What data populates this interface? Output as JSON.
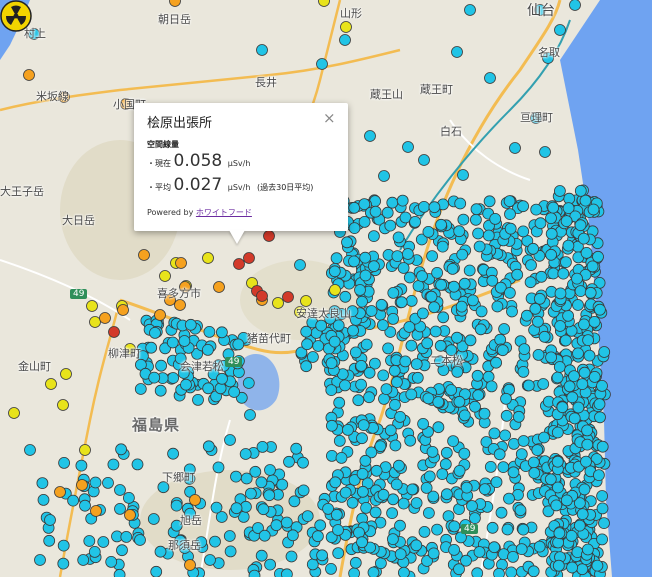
{
  "map": {
    "colors": {
      "land": "#eae7dc",
      "sea": "#6fa3f1",
      "lake": "#8fb4ea",
      "highway": "#f3bc52",
      "road": "#ffffff",
      "rail": "#33a0b0",
      "marker_cyan": "#21c4e6",
      "marker_yellow": "#e8e31b",
      "marker_orange": "#f5a11f",
      "marker_red": "#d23a2a",
      "marker_stroke": "#3a3a3a"
    },
    "place_labels": [
      "村上",
      "朝日岳",
      "山形",
      "仙台",
      "米坂線",
      "小国町",
      "長井",
      "蔵王山",
      "名取",
      "蔵王町",
      "白石",
      "亘理町",
      "大王子岳",
      "大日岳",
      "喜多方市",
      "猪苗代町",
      "安達太良山",
      "金山町",
      "柳津町",
      "福島県",
      "会津若松",
      "二本松",
      "旭岳",
      "那須岳",
      "下郷町"
    ],
    "road_numbers": [
      "49",
      "49",
      "49"
    ]
  },
  "popup": {
    "title": "桧原出張所",
    "close_glyph": "×",
    "section_label": "空間線量",
    "rows": [
      {
        "prefix": "・現在",
        "value": "0.058",
        "unit": "µSv/h",
        "note": ""
      },
      {
        "prefix": "・平均",
        "value": "0.027",
        "unit": "µSv/h",
        "note": "(過去30日平均)"
      }
    ],
    "powered_prefix": "Powered by",
    "powered_link": "ホワイトフード"
  },
  "hazard": {
    "icon": "radiation-hazard-icon"
  }
}
